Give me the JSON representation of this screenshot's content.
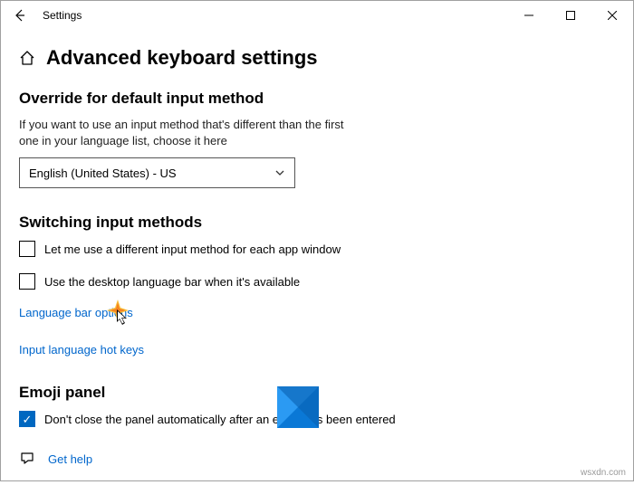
{
  "window": {
    "title": "Settings"
  },
  "page": {
    "title": "Advanced keyboard settings"
  },
  "override": {
    "section_title": "Override for default input method",
    "desc": "If you want to use an input method that's different than the first one in your language list, choose it here",
    "selected": "English (United States) - US"
  },
  "switching": {
    "section_title": "Switching input methods",
    "checkbox1_label": "Let me use a different input method for each app window",
    "checkbox2_label": "Use the desktop language bar when it's available",
    "link1": "Language bar options",
    "link2": "Input language hot keys"
  },
  "emoji": {
    "section_title": "Emoji panel",
    "checkbox_label": "Don't close the panel automatically after an emoji has been entered"
  },
  "help": {
    "label": "Get help"
  },
  "footer": {
    "text": "wsxdn.com"
  }
}
